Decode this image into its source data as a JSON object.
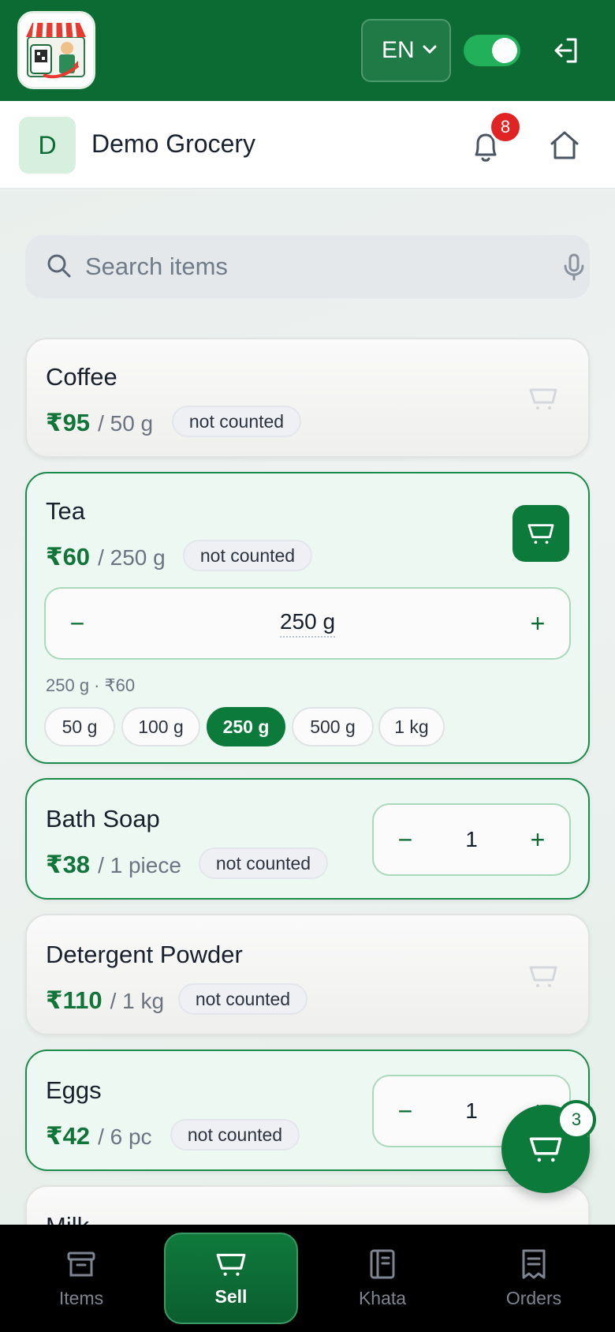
{
  "topbar": {
    "language": "EN",
    "online_toggle": true
  },
  "shop": {
    "avatar_letter": "D",
    "name": "Demo Grocery",
    "notification_count": "8"
  },
  "search": {
    "placeholder": "Search items"
  },
  "items": [
    {
      "name": "Coffee",
      "price": "₹95",
      "unit": "/ 50 g",
      "tag": "not counted"
    },
    {
      "name": "Tea",
      "price": "₹60",
      "unit": "/ 250 g",
      "tag": "not counted",
      "quantity": "250 g",
      "summary": "250 g · ₹60",
      "sizes": [
        "50 g",
        "100 g",
        "250 g",
        "500 g",
        "1 kg"
      ],
      "selected_size": "250 g"
    },
    {
      "name": "Bath Soap",
      "price": "₹38",
      "unit": "/ 1 piece",
      "tag": "not counted",
      "quantity": "1"
    },
    {
      "name": "Detergent Powder",
      "price": "₹110",
      "unit": "/ 1 kg",
      "tag": "not counted"
    },
    {
      "name": "Eggs",
      "price": "₹42",
      "unit": "/ 6 pc",
      "tag": "not counted",
      "quantity": "1"
    },
    {
      "name": "Milk"
    }
  ],
  "stepper": {
    "minus": "−",
    "plus": "+"
  },
  "cart": {
    "count": "3"
  },
  "nav": {
    "items": "Items",
    "sell": "Sell",
    "khata": "Khata",
    "orders": "Orders"
  },
  "colors": {
    "brand_green": "#0b6b32",
    "accent_green": "#0b7a3a",
    "badge_red": "#e02424"
  }
}
